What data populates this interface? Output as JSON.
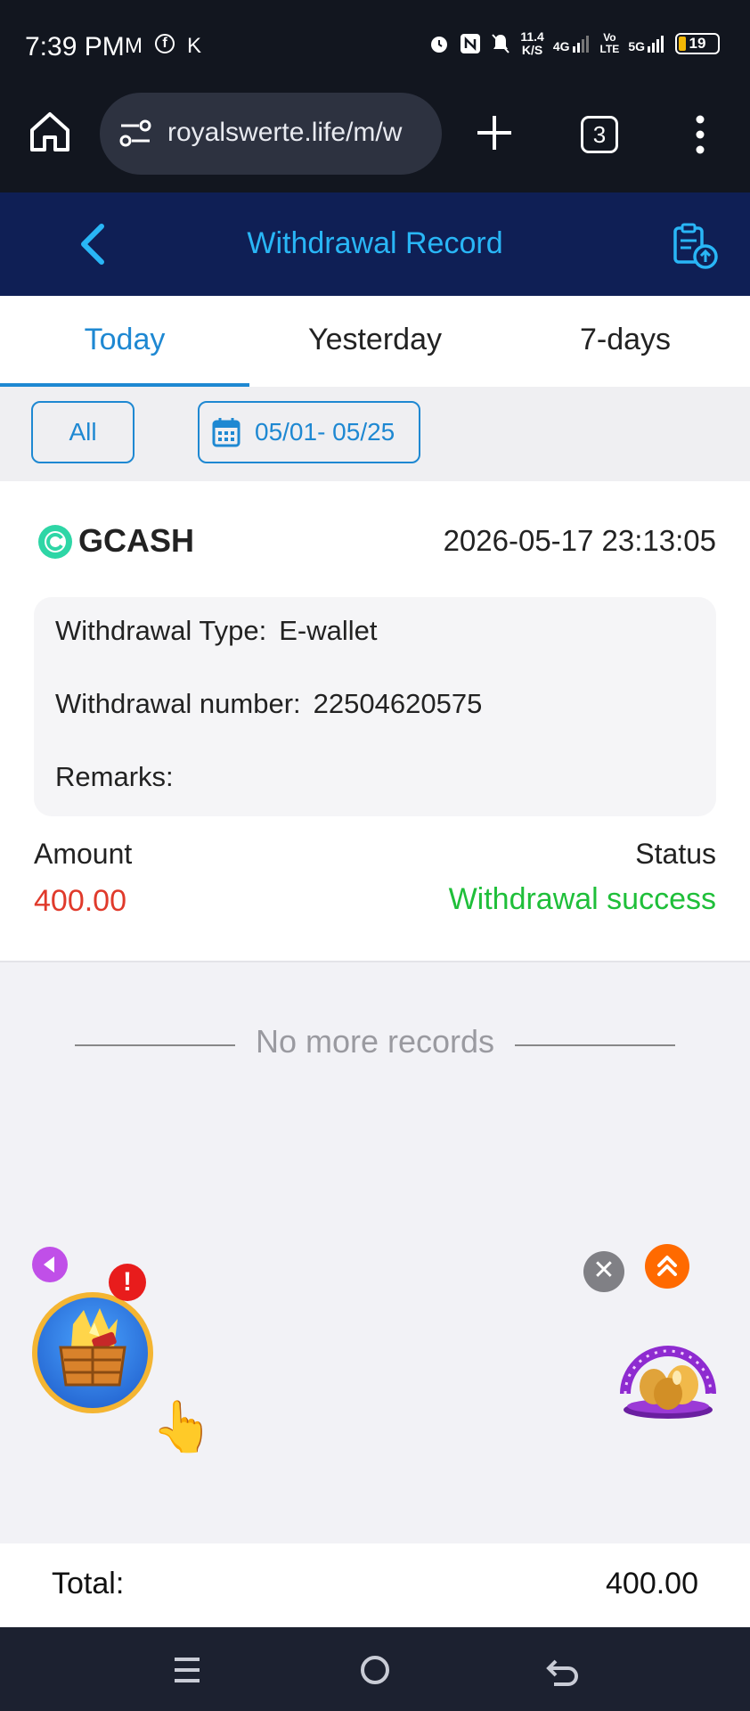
{
  "status_bar": {
    "time": "7:39 PM",
    "left_icons": [
      "M",
      "f",
      "K"
    ],
    "net_speed_value": "11.4",
    "net_speed_unit": "K/S",
    "signal_1": "4G",
    "signal_2_top": "Vo",
    "signal_2_bottom": "LTE",
    "signal_3": "5G",
    "battery": "19"
  },
  "browser": {
    "url": "royalswerte.life/m/w",
    "tab_count": "3"
  },
  "header": {
    "title": "Withdrawal Record"
  },
  "tabs": [
    {
      "label": "Today",
      "active": true
    },
    {
      "label": "Yesterday",
      "active": false
    },
    {
      "label": "7-days",
      "active": false
    }
  ],
  "filters": {
    "all_label": "All",
    "date_range": "05/01- 05/25"
  },
  "record": {
    "method": "GCASH",
    "datetime": "2026-05-17 23:13:05",
    "type_label": "Withdrawal Type:",
    "type_value": "E-wallet",
    "number_label": "Withdrawal number:",
    "number_value": "22504620575",
    "remarks_label": "Remarks:",
    "remarks_value": "",
    "amount_label": "Amount",
    "amount_value": "400.00",
    "status_label": "Status",
    "status_value": "Withdrawal success"
  },
  "list_end": {
    "text": "No more records"
  },
  "floating": {
    "alert_text": "!",
    "close_text": "✕",
    "hand_icon": "👆"
  },
  "total": {
    "label": "Total:",
    "value": "400.00"
  },
  "colors": {
    "header_bg": "#0f1f55",
    "accent": "#1e88d2",
    "amount": "#e03a2b",
    "success": "#1fbf3a"
  }
}
